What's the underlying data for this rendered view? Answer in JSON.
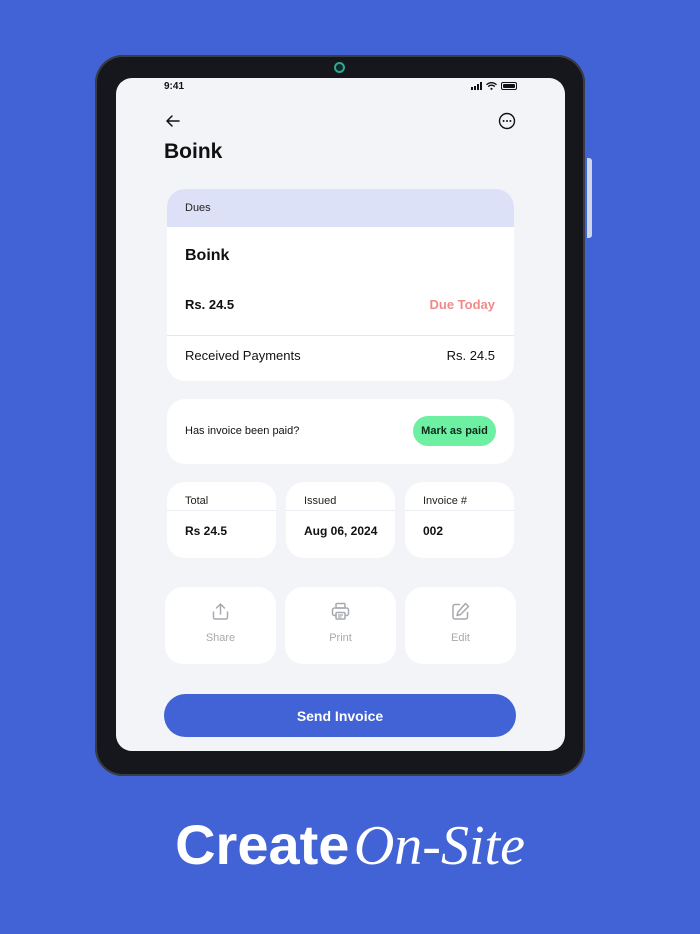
{
  "status_bar": {
    "time": "9:41"
  },
  "header": {
    "title": "Boink"
  },
  "dues": {
    "section_label": "Dues",
    "client_name": "Boink",
    "amount": "Rs. 24.5",
    "status": "Due Today",
    "received_label": "Received Payments",
    "received_value": "Rs. 24.5",
    "status_color": "#f08a8a"
  },
  "payment": {
    "question": "Has invoice been paid?",
    "mark_paid_label": "Mark as paid",
    "accent": "#6ef0a3"
  },
  "summary": [
    {
      "label": "Total",
      "value": "Rs 24.5"
    },
    {
      "label": "Issued",
      "value": "Aug 06, 2024"
    },
    {
      "label": "Invoice #",
      "value": "002"
    }
  ],
  "actions": [
    {
      "label": "Share",
      "icon": "share-icon"
    },
    {
      "label": "Print",
      "icon": "printer-icon"
    },
    {
      "label": "Edit",
      "icon": "edit-icon"
    }
  ],
  "send_button": {
    "label": "Send Invoice",
    "color": "#4263d6"
  },
  "tagline": {
    "bold": "Create",
    "italic": "On-Site"
  }
}
